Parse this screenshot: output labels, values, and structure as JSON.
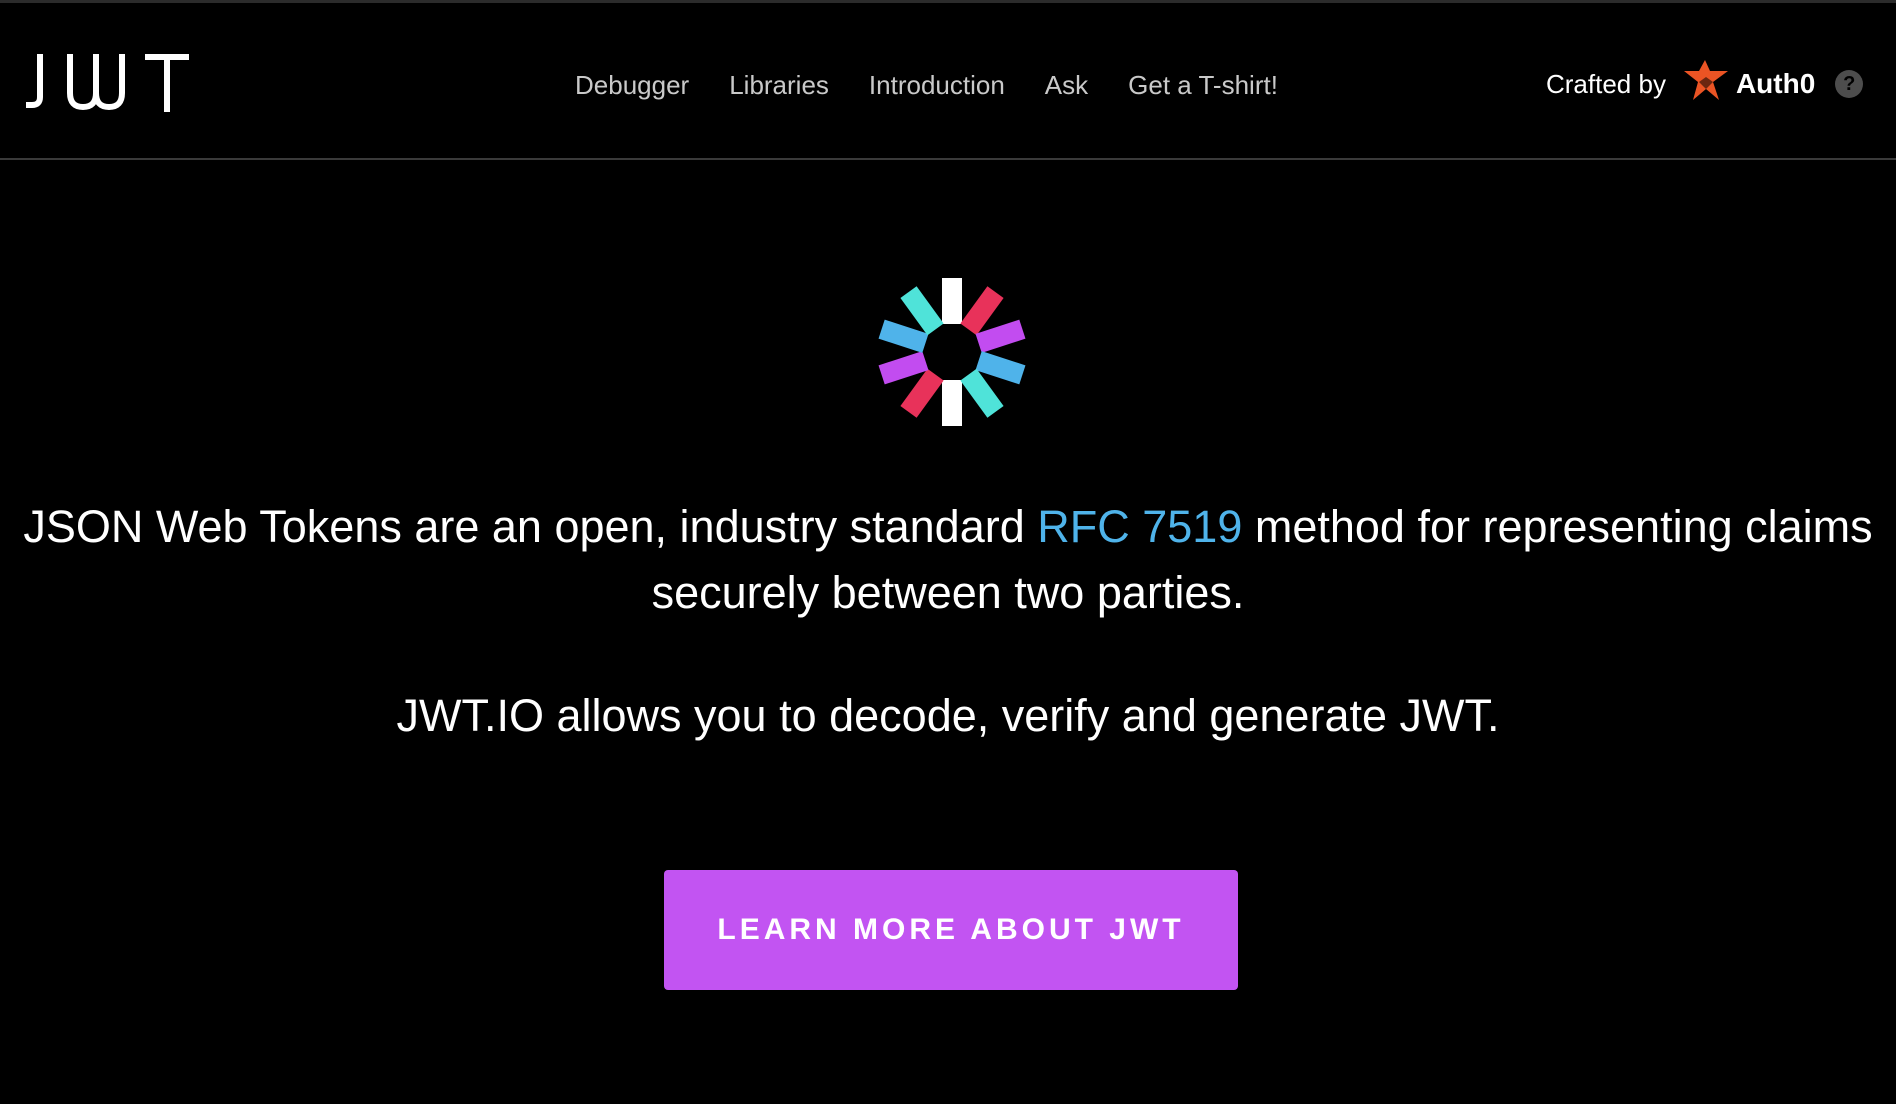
{
  "header": {
    "logo_text": "JWT",
    "nav": [
      {
        "label": "Debugger"
      },
      {
        "label": "Libraries"
      },
      {
        "label": "Introduction"
      },
      {
        "label": "Ask"
      },
      {
        "label": "Get a T-shirt!"
      }
    ],
    "crafted_by": "Crafted by",
    "brand": "Auth0",
    "help": "?"
  },
  "hero": {
    "headline_before": "JSON Web Tokens are an open, industry standard ",
    "rfc_link": "RFC 7519",
    "headline_after": " method for representing claims securely between two parties.",
    "subline": "JWT.IO allows you to decode, verify and generate JWT.",
    "cta_label": "LEARN MORE ABOUT JWT"
  },
  "colors": {
    "background": "#000000",
    "accent_link": "#4fb3ea",
    "cta": "#c254f2",
    "auth0": "#eb5424"
  }
}
